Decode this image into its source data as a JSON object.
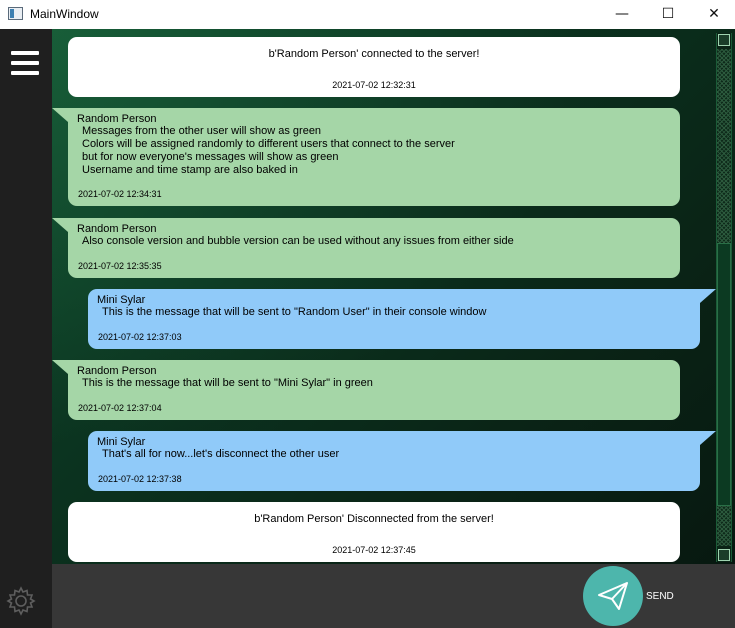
{
  "window": {
    "title": "MainWindow",
    "minimize_glyph": "—",
    "maximize_glyph": "☐",
    "close_glyph": "✕"
  },
  "sidebar": {
    "menu_icon": "hamburger-menu-icon",
    "settings_icon": "gear-icon"
  },
  "colors": {
    "server_bubble": "#ffffff",
    "green_bubble": "#a5d6a7",
    "blue_bubble": "#90caf9",
    "send_button": "#4db6ac"
  },
  "scrollbar": {
    "thumb_start": 0.39,
    "thumb_size": 0.53
  },
  "messages": [
    {
      "type": "server",
      "text": "b'Random Person' connected to the server!",
      "time": "2021-07-02 12:32:31"
    },
    {
      "type": "green",
      "user": "Random Person",
      "lines": [
        "Messages from the other user will show as green",
        "Colors will be assigned randomly to different users that connect to the server",
        "but for now everyone's messages will show as green",
        "Username and time stamp are also baked in"
      ],
      "time": "2021-07-02 12:34:31"
    },
    {
      "type": "green",
      "user": "Random Person",
      "lines": [
        "Also console version and bubble version can be used without any issues from either side"
      ],
      "time": "2021-07-02 12:35:35"
    },
    {
      "type": "blue",
      "user": "Mini Sylar",
      "lines": [
        "This is the message that will be sent to \"Random User\" in their console window"
      ],
      "time": "2021-07-02 12:37:03"
    },
    {
      "type": "green",
      "user": "Random Person",
      "lines": [
        "This is the message that will be sent to \"Mini Sylar\" in green"
      ],
      "time": "2021-07-02 12:37:04"
    },
    {
      "type": "blue",
      "user": "Mini Sylar",
      "lines": [
        "That's all for now...let's disconnect the other user"
      ],
      "time": "2021-07-02 12:37:38"
    },
    {
      "type": "server",
      "text": "b'Random Person' Disconnected from the server!",
      "time": "2021-07-02 12:37:45"
    }
  ],
  "input": {
    "value": "",
    "placeholder": ""
  },
  "send": {
    "label": "SEND",
    "icon": "paper-plane-send-icon"
  }
}
